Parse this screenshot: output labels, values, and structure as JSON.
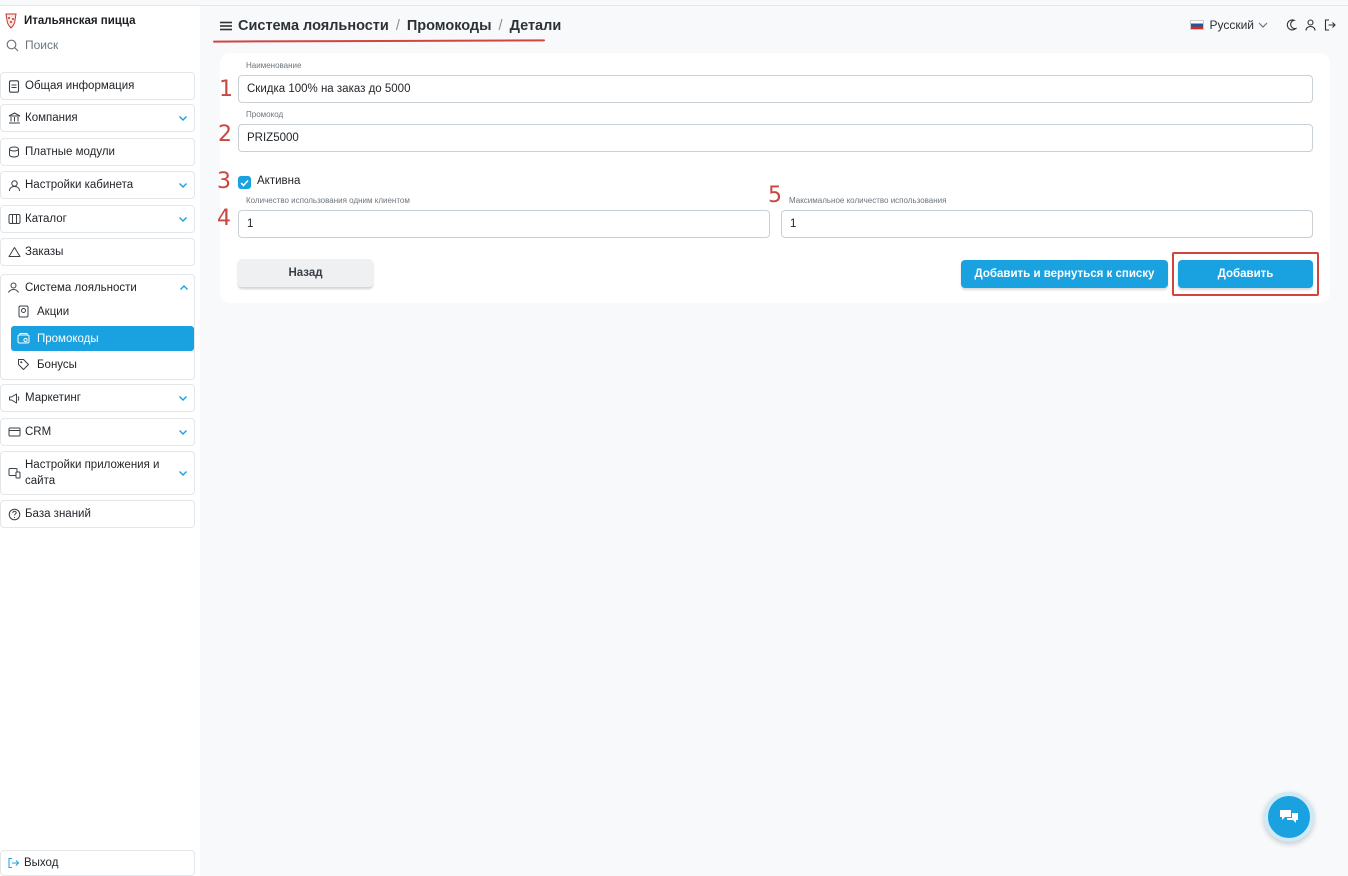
{
  "app": {
    "title": "Итальянская пицца"
  },
  "search": {
    "label": "Поиск"
  },
  "sidebar": {
    "items": [
      {
        "label": "Общая информация",
        "icon": "document-icon"
      },
      {
        "label": "Компания",
        "icon": "bank-icon"
      },
      {
        "label": "Платные модули",
        "icon": "coins-icon"
      },
      {
        "label": "Настройки кабинета",
        "icon": "user-settings-icon"
      },
      {
        "label": "Каталог",
        "icon": "catalog-icon"
      },
      {
        "label": "Заказы",
        "icon": "triangle-icon"
      }
    ],
    "loyalty": {
      "label": "Система лояльности",
      "icon": "loyalty-icon",
      "children": [
        {
          "label": "Акции",
          "icon": "badge-icon"
        },
        {
          "label": "Промокоды",
          "icon": "promo-icon",
          "active": true
        },
        {
          "label": "Бонусы",
          "icon": "tag-icon"
        }
      ]
    },
    "items_after": [
      {
        "label": "Маркетинг",
        "icon": "megaphone-icon"
      },
      {
        "label": "CRM",
        "icon": "crm-icon"
      },
      {
        "label": "Настройки приложения и сайта",
        "icon": "devices-icon"
      },
      {
        "label": "База знаний",
        "icon": "help-icon"
      }
    ],
    "exit_label": "Выход"
  },
  "header": {
    "breadcrumbs": [
      "Система лояльности",
      "Промокоды",
      "Детали"
    ],
    "separator": "/",
    "language": "Русский"
  },
  "form": {
    "name": {
      "label": "Наименование",
      "value": "Скидка 100% на заказ до 5000"
    },
    "promo": {
      "label": "Промокод",
      "value": "PRIZ5000"
    },
    "active": {
      "label": "Активна",
      "checked": true
    },
    "per_client": {
      "label": "Количество использования одним клиентом",
      "value": "1"
    },
    "max_uses": {
      "label": "Максимальное количество использования",
      "value": "1"
    },
    "buttons": {
      "back": "Назад",
      "add_and_return": "Добавить и вернуться к списку",
      "add": "Добавить"
    }
  },
  "annotations": [
    "1",
    "2",
    "3",
    "4",
    "5"
  ],
  "colors": {
    "accent": "#1aa1e0",
    "annotation": "#d0463f"
  }
}
